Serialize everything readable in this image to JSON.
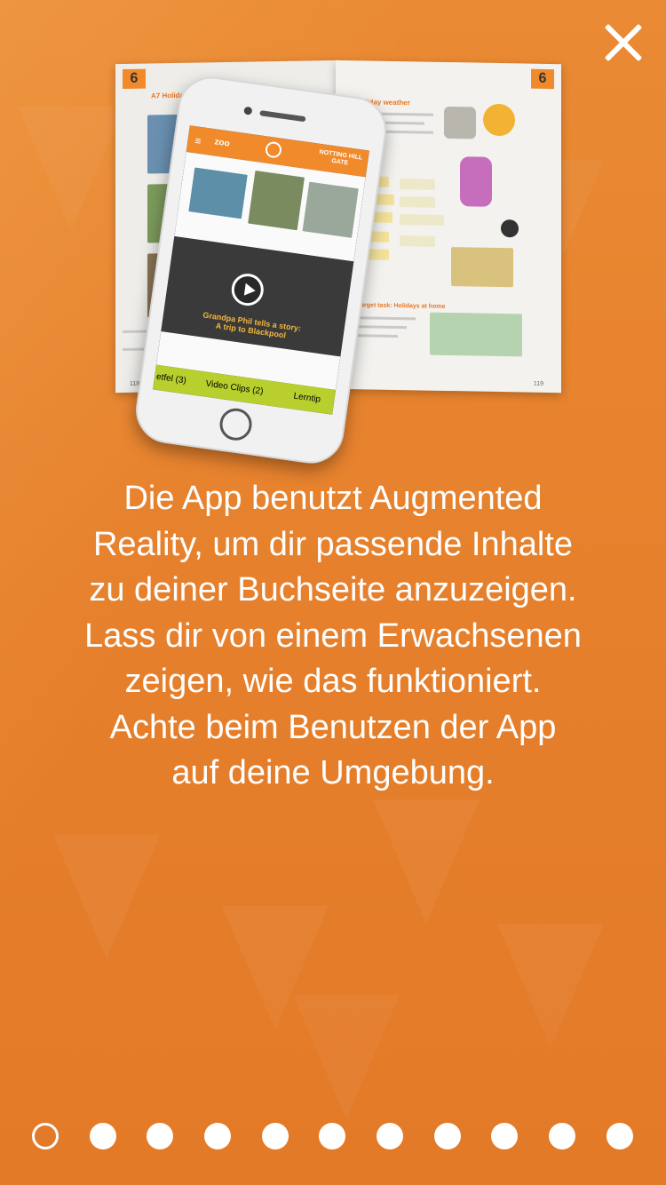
{
  "close_icon": "close-icon",
  "illustration": {
    "book_left_page_number": "6",
    "book_right_page_number": "6",
    "book_left_heading": "A7 Holiday fun",
    "book_right_heading": "A9 Holiday weather",
    "book_right_footer": "119",
    "book_left_footer": "118",
    "phone_app_logo": "zoo",
    "phone_app_badge": "NOTTING HILL GATE",
    "video_caption_line1": "Grandpa Phil tells a story:",
    "video_caption_line2": "A trip to Blackpool",
    "tab_left": "etfel (3)",
    "tab_middle": "Video Clips (2)",
    "tab_right": "Lerntip"
  },
  "message_lines": [
    "Die App benutzt Augmented",
    "Reality, um dir passende Inhalte",
    "zu deiner Buchseite anzuzeigen.",
    "Lass dir von einem Erwachsenen",
    "zeigen, wie das funktioniert.",
    "Achte beim Benutzen der App",
    "auf deine Umgebung."
  ],
  "pagination": {
    "total": 11,
    "active_index": 0
  },
  "colors": {
    "background": "#E8822E",
    "text": "#FFFFFF",
    "accent": "#F08A2A"
  }
}
